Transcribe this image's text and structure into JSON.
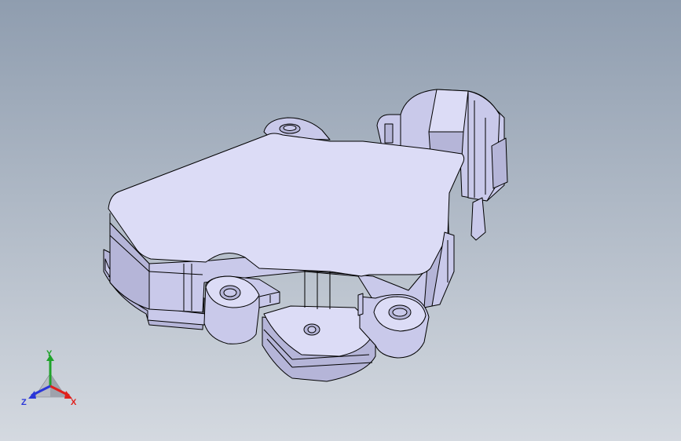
{
  "viewport": {
    "background_top": "#8f9daf",
    "background_bottom": "#d4d9e0"
  },
  "model": {
    "face_top": "#dcdcf6",
    "face_side": "#c9c9ea",
    "face_shadow": "#b5b5d8",
    "edge": "#000000"
  },
  "triad": {
    "x_label": "X",
    "y_label": "Y",
    "z_label": "Z",
    "x_color": "#e0201c",
    "y_color": "#1fa32a",
    "z_color": "#2a36d8"
  }
}
